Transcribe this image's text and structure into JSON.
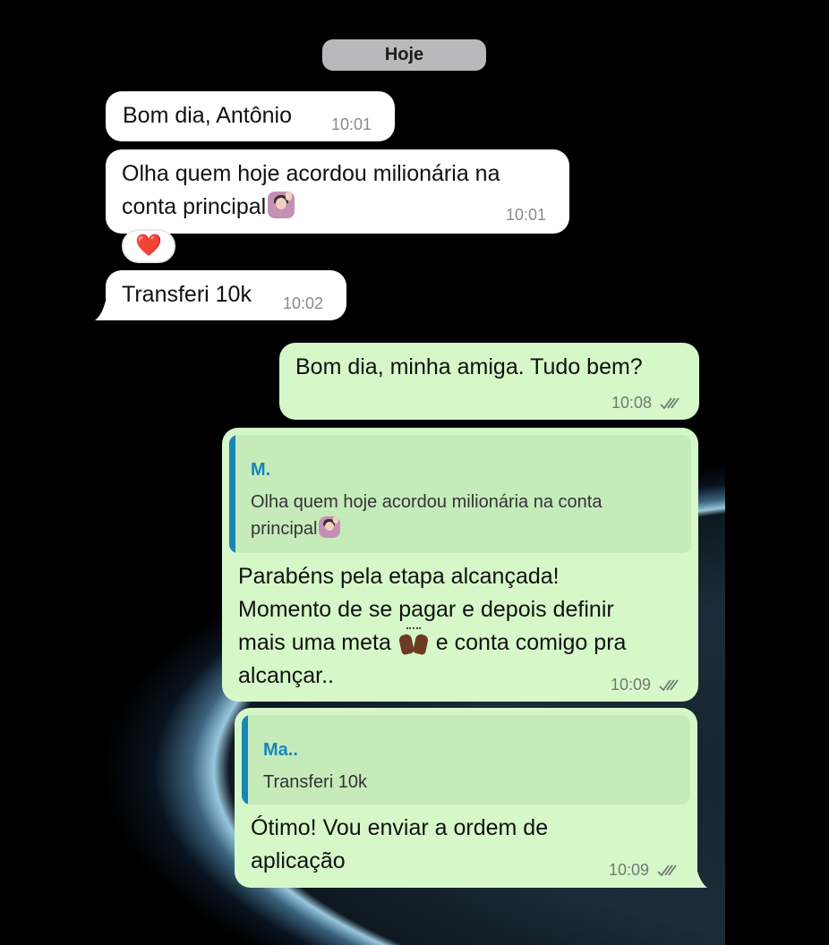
{
  "chat": {
    "date_label": "Hoje",
    "reaction": "❤️",
    "messages": [
      {
        "id": "m1",
        "direction": "incoming",
        "text": "Bom dia, Antônio",
        "time": "10:01"
      },
      {
        "id": "m2",
        "direction": "incoming",
        "line1": "Olha quem hoje acordou milionária na",
        "line2": "conta principal",
        "emoji": "woman-raising-hand",
        "time": "10:01"
      },
      {
        "id": "m3",
        "direction": "incoming",
        "text": "Transferi 10k",
        "time": "10:02"
      },
      {
        "id": "m4",
        "direction": "outgoing",
        "text": "Bom dia, minha amiga. Tudo bem?",
        "time": "10:08",
        "status": "read"
      },
      {
        "id": "m5",
        "direction": "outgoing",
        "quote": {
          "name": "M.",
          "line1": "Olha quem hoje acordou milionária na conta",
          "line2": "principal",
          "emoji": "woman-raising-hand"
        },
        "line1": "Parabéns pela etapa alcançada!",
        "line2": "Momento de se pagar e depois definir",
        "line3_before": "mais uma meta",
        "line3_emoji": "raising-hands",
        "line3_after": "e conta comigo pra",
        "line4": "alcançar..",
        "time": "10:09",
        "status": "read"
      },
      {
        "id": "m6",
        "direction": "outgoing",
        "quote": {
          "name": "Ma..",
          "text": "Transferi 10k"
        },
        "line1": "Ótimo! Vou enviar a ordem de",
        "line2": "aplicação",
        "time": "10:09",
        "status": "read"
      }
    ]
  },
  "colors": {
    "incoming_bubble": "#ffffff",
    "outgoing_bubble": "#d6f8c9",
    "quote_accent": "#1686b8",
    "date_pill": "#b9b9bb"
  }
}
